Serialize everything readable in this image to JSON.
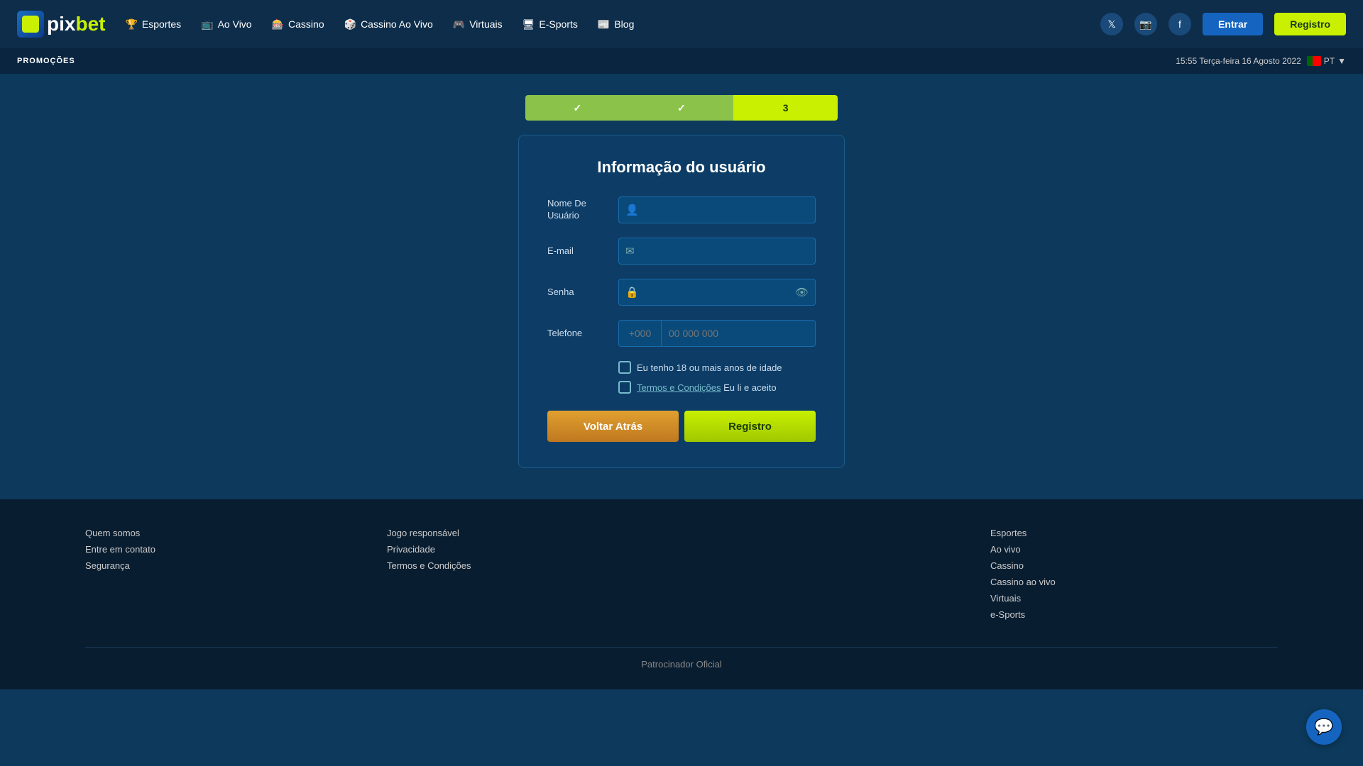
{
  "logo": {
    "pix": "pix",
    "bet": "bet"
  },
  "nav": {
    "items": [
      {
        "label": "Esportes",
        "icon": "🏆"
      },
      {
        "label": "Ao Vivo",
        "icon": "📺"
      },
      {
        "label": "Cassino",
        "icon": "🎰"
      },
      {
        "label": "Cassino Ao Vivo",
        "icon": "🎲"
      },
      {
        "label": "Virtuais",
        "icon": "🎮"
      },
      {
        "label": "E-Sports",
        "icon": "🖥"
      },
      {
        "label": "Blog",
        "icon": "📰"
      }
    ]
  },
  "header": {
    "entrar_label": "Entrar",
    "registro_label": "Registro"
  },
  "promo_bar": {
    "label": "PROMOÇÕES",
    "datetime": "15:55 Terça-feira 16 Agosto 2022",
    "lang": "PT"
  },
  "steps": [
    {
      "label": "✓",
      "state": "done"
    },
    {
      "label": "✓",
      "state": "done"
    },
    {
      "label": "3",
      "state": "current"
    }
  ],
  "form": {
    "title": "Informação do usuário",
    "fields": {
      "username_label": "Nome De Usuário",
      "email_label": "E-mail",
      "password_label": "Senha",
      "phone_label": "Telefone"
    },
    "placeholders": {
      "username": "",
      "email": "",
      "password": "",
      "phone_prefix": "+000",
      "phone_number": "00 000 000"
    },
    "checkboxes": {
      "age_label": "Eu tenho 18 ou mais anos de idade",
      "terms_link": "Termos e Condições",
      "terms_suffix": " Eu li e aceito"
    },
    "buttons": {
      "back_label": "Voltar Atrás",
      "register_label": "Registro"
    }
  },
  "footer": {
    "cols": [
      {
        "title": "",
        "links": [
          "Quem somos",
          "Entre em contato",
          "Segurança"
        ]
      },
      {
        "title": "",
        "links": [
          "Jogo responsável",
          "Privacidade",
          "Termos e Condições"
        ]
      },
      {
        "title": "",
        "links": []
      },
      {
        "title": "",
        "links": [
          "Esportes",
          "Ao vivo",
          "Cassino",
          "Cassino ao vivo",
          "Virtuais",
          "e-Sports"
        ]
      }
    ],
    "sponsor": "Patrocinador Oficial"
  }
}
